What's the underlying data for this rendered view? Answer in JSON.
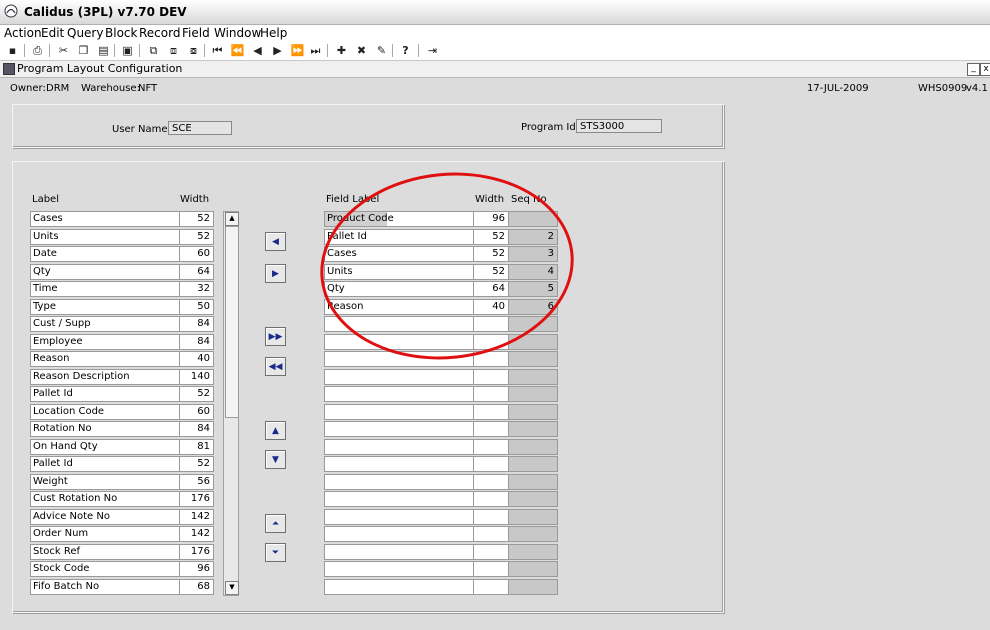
{
  "app": {
    "title": "Calidus (3PL) v7.70 DEV"
  },
  "menu": [
    "Action",
    "Edit",
    "Query",
    "Block",
    "Record",
    "Field",
    "Window",
    "Help"
  ],
  "toolbar_icons": [
    "save-icon",
    "print-icon",
    "cut-icon",
    "copy-icon",
    "paste-icon",
    "clear-icon",
    "query-icon",
    "execute-icon",
    "cancel-icon",
    "first-record-icon",
    "prev-set-icon",
    "prev-record-icon",
    "next-record-icon",
    "next-set-icon",
    "last-record-icon",
    "insert-icon",
    "delete-icon",
    "duplicate-icon",
    "help-icon",
    "exit-icon"
  ],
  "window": {
    "title": "Program Layout Configuration"
  },
  "info": {
    "owner_label": "Owner:",
    "owner": "DRM",
    "warehouse_label": "Warehouse:",
    "warehouse": "NFT",
    "date": "17-JUL-2009",
    "program_code": "WHS0909",
    "version": "v4.1"
  },
  "header_form": {
    "user_label": "User Name:",
    "user_value": "SCE",
    "program_label": "Program Id:",
    "program_value": "STS3000"
  },
  "available": {
    "label_header": "Label",
    "width_header": "Width",
    "rows": [
      {
        "label": "Cases",
        "width": "52"
      },
      {
        "label": "Units",
        "width": "52"
      },
      {
        "label": "Date",
        "width": "60"
      },
      {
        "label": "Qty",
        "width": "64"
      },
      {
        "label": "Time",
        "width": "32"
      },
      {
        "label": "Type",
        "width": "50"
      },
      {
        "label": "Cust / Supp",
        "width": "84"
      },
      {
        "label": "Employee",
        "width": "84"
      },
      {
        "label": "Reason",
        "width": "40"
      },
      {
        "label": "Reason Description",
        "width": "140"
      },
      {
        "label": "Pallet Id",
        "width": "52"
      },
      {
        "label": "Location Code",
        "width": "60"
      },
      {
        "label": "Rotation No",
        "width": "84"
      },
      {
        "label": "On Hand Qty",
        "width": "81"
      },
      {
        "label": "Pallet Id",
        "width": "52"
      },
      {
        "label": "Weight",
        "width": "56"
      },
      {
        "label": "Cust Rotation No",
        "width": "176"
      },
      {
        "label": "Advice Note No",
        "width": "142"
      },
      {
        "label": "Order Num",
        "width": "142"
      },
      {
        "label": "Stock Ref",
        "width": "176"
      },
      {
        "label": "Stock Code",
        "width": "96"
      },
      {
        "label": "Fifo Batch No",
        "width": "68"
      }
    ]
  },
  "selected": {
    "label_header": "Field Label",
    "width_header": "Width",
    "seq_header": "Seq No",
    "rows": [
      {
        "label": "Product Code",
        "width": "96",
        "seq": ""
      },
      {
        "label": "Pallet Id",
        "width": "52",
        "seq": "2"
      },
      {
        "label": "Cases",
        "width": "52",
        "seq": "3"
      },
      {
        "label": "Units",
        "width": "52",
        "seq": "4"
      },
      {
        "label": "Qty",
        "width": "64",
        "seq": "5"
      },
      {
        "label": "Reason",
        "width": "40",
        "seq": "6"
      },
      {
        "label": "",
        "width": "",
        "seq": ""
      },
      {
        "label": "",
        "width": "",
        "seq": ""
      },
      {
        "label": "",
        "width": "",
        "seq": ""
      },
      {
        "label": "",
        "width": "",
        "seq": ""
      },
      {
        "label": "",
        "width": "",
        "seq": ""
      },
      {
        "label": "",
        "width": "",
        "seq": ""
      },
      {
        "label": "",
        "width": "",
        "seq": ""
      },
      {
        "label": "",
        "width": "",
        "seq": ""
      },
      {
        "label": "",
        "width": "",
        "seq": ""
      },
      {
        "label": "",
        "width": "",
        "seq": ""
      },
      {
        "label": "",
        "width": "",
        "seq": ""
      },
      {
        "label": "",
        "width": "",
        "seq": ""
      },
      {
        "label": "",
        "width": "",
        "seq": ""
      },
      {
        "label": "",
        "width": "",
        "seq": ""
      },
      {
        "label": "",
        "width": "",
        "seq": ""
      },
      {
        "label": "",
        "width": "",
        "seq": ""
      }
    ]
  },
  "colors": {
    "accent": "#1a2a8a",
    "annotation": "#e01010",
    "background": "#dcdcdc"
  }
}
